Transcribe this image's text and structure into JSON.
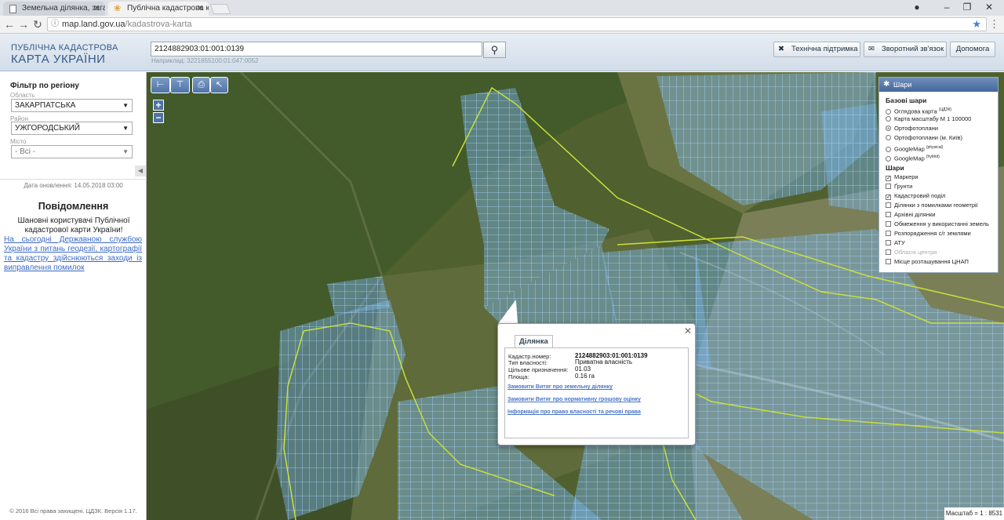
{
  "browser": {
    "tabs": [
      {
        "title": "Земельна ділянка, загал"
      },
      {
        "title": "Публічна кадастрова ка"
      }
    ],
    "url_host": "map.land.gov.ua",
    "url_path": "/kadastrova-karta"
  },
  "header": {
    "logo_line1": "ПУБЛІЧНА КАДАСТРОВА",
    "logo_line2": "КАРТА УКРАЇНИ",
    "search_value": "2124882903:01:001:0139",
    "search_hint": "Наприклад: 3221655100:01:047:0052",
    "buttons": {
      "support": "Технічна підтримка",
      "feedback": "Зворотний зв'язок",
      "help": "Допомога"
    }
  },
  "filter": {
    "title": "Фільтр по регіону",
    "oblast_label": "Область",
    "oblast_value": "ЗАКАРПАТСЬКА",
    "rayon_label": "Район",
    "rayon_value": "УЖГОРОДСЬКИЙ",
    "city_label": "Місто",
    "city_value": "- Всі -"
  },
  "updated": "Дата оновлення: 14.05.2018 03:00",
  "notice": {
    "title": "Повідомлення",
    "text": "Шановні користувачі Публічної кадастрової карти України!",
    "link": "На сьогодні Державною службою України з питань геодезії, картографії та кадастру здійснюються заходи із виправлення помилок"
  },
  "copyright": "© 2016 Всі права захищені. ЦДЗК. Версія 1.17.",
  "layers": {
    "title": "Шари",
    "base_title": "Базові шари",
    "base": [
      {
        "label": "Оглядова карта",
        "sup": "(ЦДЗК)",
        "selected": false
      },
      {
        "label": "Карта масштабу М 1 100000",
        "sup": "",
        "selected": false
      },
      {
        "label": "Ортофотоплани",
        "sup": "",
        "selected": true
      },
      {
        "label": "Ортофотоплани (м. Київ)",
        "sup": "",
        "selected": false
      },
      {
        "label": "GoogleMap",
        "sup": "(physical)",
        "selected": false
      },
      {
        "label": "GoogleMap",
        "sup": "(hybrid)",
        "selected": false
      }
    ],
    "overlay_title": "Шари",
    "overlay": [
      {
        "label": "Маркери",
        "checked": true,
        "disabled": false
      },
      {
        "label": "Ґрунти",
        "checked": false,
        "disabled": false
      },
      {
        "label": "Кадастровий поділ",
        "checked": true,
        "disabled": false
      },
      {
        "label": "Ділянки з помилками геометрії",
        "checked": false,
        "disabled": false
      },
      {
        "label": "Архівні ділянки",
        "checked": false,
        "disabled": false
      },
      {
        "label": "Обмеження у використанні земель",
        "checked": false,
        "disabled": false
      },
      {
        "label": "Розпорядження с/г землями",
        "checked": false,
        "disabled": false
      },
      {
        "label": "АТУ",
        "checked": false,
        "disabled": false
      },
      {
        "label": "Обласні центри",
        "checked": false,
        "disabled": true
      },
      {
        "label": "Місце розташування ЦНАП",
        "checked": false,
        "disabled": false
      }
    ]
  },
  "popup": {
    "tab": "Ділянка",
    "rows": [
      {
        "label": "Кадастр.номер:",
        "value": "2124882903:01:001:0139"
      },
      {
        "label": "Тип власності:",
        "value": "Приватна власність"
      },
      {
        "label": "Цільове призначення:",
        "value": "01.03"
      },
      {
        "label": "Площа:",
        "value": "0.16 га"
      }
    ],
    "links": [
      "Замовити Витяг про земельну ділянку",
      "Замовити Витяг про нормативну грошову оцінку",
      "Інформація про право власності та речові права"
    ]
  },
  "scale": "Масштаб = 1 : 8531",
  "colors": {
    "accent": "#44689c",
    "parcel": "#78b4e8",
    "boundary": "#c8e03a"
  }
}
